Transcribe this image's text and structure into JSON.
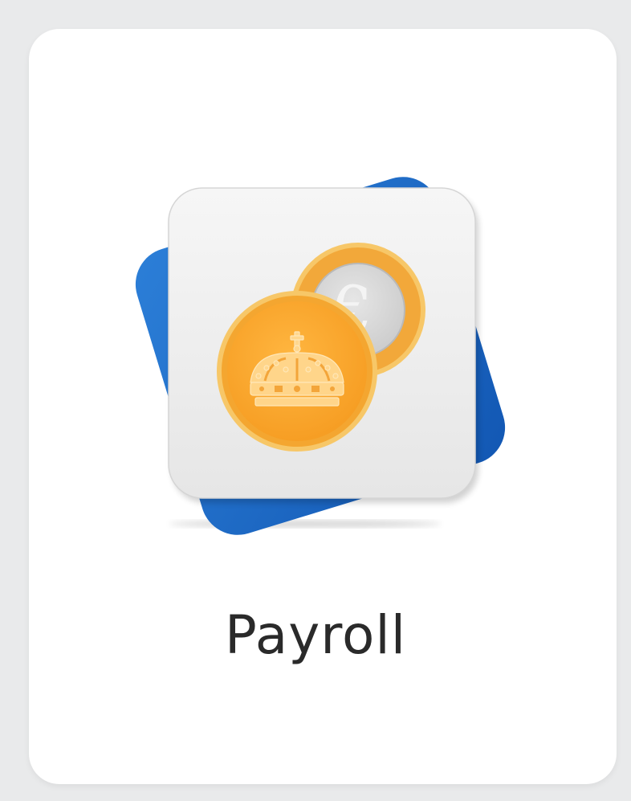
{
  "app": {
    "label": "Payroll",
    "icon": "payroll-coins-icon",
    "coin_front_emblem": "crown-icon",
    "coin_back_symbol": "€"
  },
  "colors": {
    "page_background": "#e9eaeb",
    "card_background": "#ffffff",
    "back_tile": "#1f6fc8",
    "front_tile": "#f1f1f1",
    "coin_gold": "#f8a62c",
    "coin_rim": "#f7c768",
    "coin_silver": "#d9d9d9",
    "label_text": "#2a2a2a"
  }
}
